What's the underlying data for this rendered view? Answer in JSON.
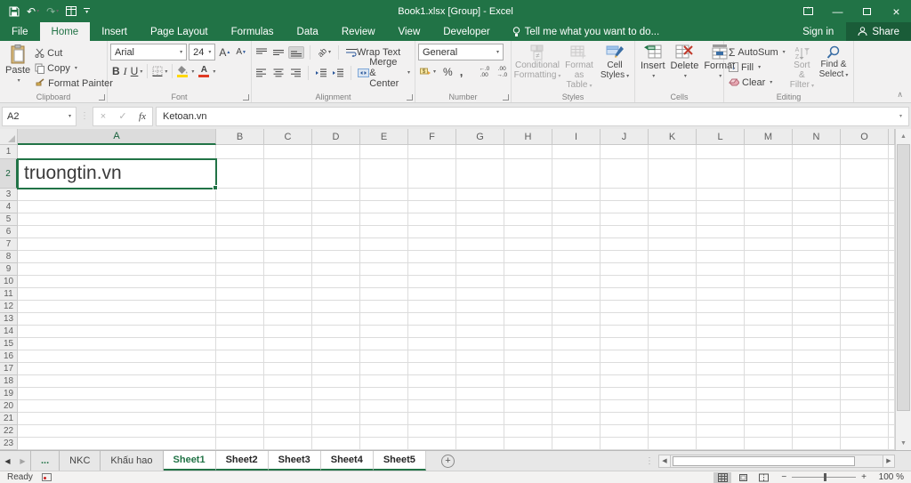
{
  "titlebar": {
    "title": "Book1.xlsx  [Group] - Excel"
  },
  "account": {
    "sign_in": "Sign in",
    "share": "Share"
  },
  "ribbon_tabs": {
    "items": [
      {
        "label": "File",
        "type": "file"
      },
      {
        "label": "Home",
        "active": true
      },
      {
        "label": "Insert"
      },
      {
        "label": "Page Layout"
      },
      {
        "label": "Formulas"
      },
      {
        "label": "Data"
      },
      {
        "label": "Review"
      },
      {
        "label": "View"
      },
      {
        "label": "Developer"
      }
    ],
    "tellme": "Tell me what you want to do..."
  },
  "ribbon": {
    "clipboard": {
      "label": "Clipboard",
      "paste": "Paste",
      "cut": "Cut",
      "copy": "Copy",
      "format_painter": "Format Painter"
    },
    "font": {
      "label": "Font",
      "family": "Arial",
      "size": "24"
    },
    "alignment": {
      "label": "Alignment",
      "wrap": "Wrap Text",
      "merge": "Merge & Center"
    },
    "number": {
      "label": "Number",
      "format": "General"
    },
    "styles": {
      "label": "Styles",
      "conditional_1": "Conditional",
      "conditional_2": "Formatting",
      "table_1": "Format as",
      "table_2": "Table",
      "cell_1": "Cell",
      "cell_2": "Styles"
    },
    "cells": {
      "label": "Cells",
      "insert": "Insert",
      "delete": "Delete",
      "format": "Format"
    },
    "editing": {
      "label": "Editing",
      "autosum": "AutoSum",
      "fill": "Fill",
      "clear": "Clear",
      "sort_1": "Sort &",
      "sort_2": "Filter",
      "find_1": "Find &",
      "find_2": "Select"
    }
  },
  "formula_bar": {
    "name_box": "A2",
    "formula": "Ketoan.vn"
  },
  "grid": {
    "columns": [
      "A",
      "B",
      "C",
      "D",
      "E",
      "F",
      "G",
      "H",
      "I",
      "J",
      "K",
      "L",
      "M",
      "N",
      "O"
    ],
    "row_count": 23,
    "active_cell": {
      "ref": "A2",
      "col": "A",
      "row": 2,
      "text": "truongtin.vn"
    }
  },
  "sheet_tabs": {
    "items": [
      {
        "label": "...",
        "type": "ellipsis"
      },
      {
        "label": "NKC",
        "type": "inactive"
      },
      {
        "label": "Khấu hao",
        "type": "inactive"
      },
      {
        "label": "Sheet1",
        "type": "active"
      },
      {
        "label": "Sheet2",
        "type": "group"
      },
      {
        "label": "Sheet3",
        "type": "group"
      },
      {
        "label": "Sheet4",
        "type": "group"
      },
      {
        "label": "Sheet5",
        "type": "group"
      }
    ]
  },
  "status_bar": {
    "mode": "Ready",
    "zoom": "100 %"
  },
  "glyphs": {
    "undo": "↶",
    "redo": "↷",
    "dd": "▾",
    "close": "×",
    "minimize": "—",
    "bold": "B",
    "italic": "I",
    "underline": "U",
    "grow_font": "A",
    "shrink_font": "A",
    "up_tri": "▲",
    "down_tri": "▼",
    "left_tri": "◀",
    "right_tri": "▶",
    "autosum": "Σ",
    "fill_arrow": "↓",
    "percent": "%",
    "comma": ",",
    "accounting": "$",
    "font_color": "A",
    "fx": "fx",
    "x_btn": "×",
    "check_btn": "✓",
    "dots": "⋮",
    "inc_top": "←.0",
    "inc_bot": ".00",
    "dec_top": ".00",
    "dec_bot": "→.0",
    "collapse": "∧",
    "plus": "+",
    "minus": "−",
    "orientation": "ab"
  }
}
